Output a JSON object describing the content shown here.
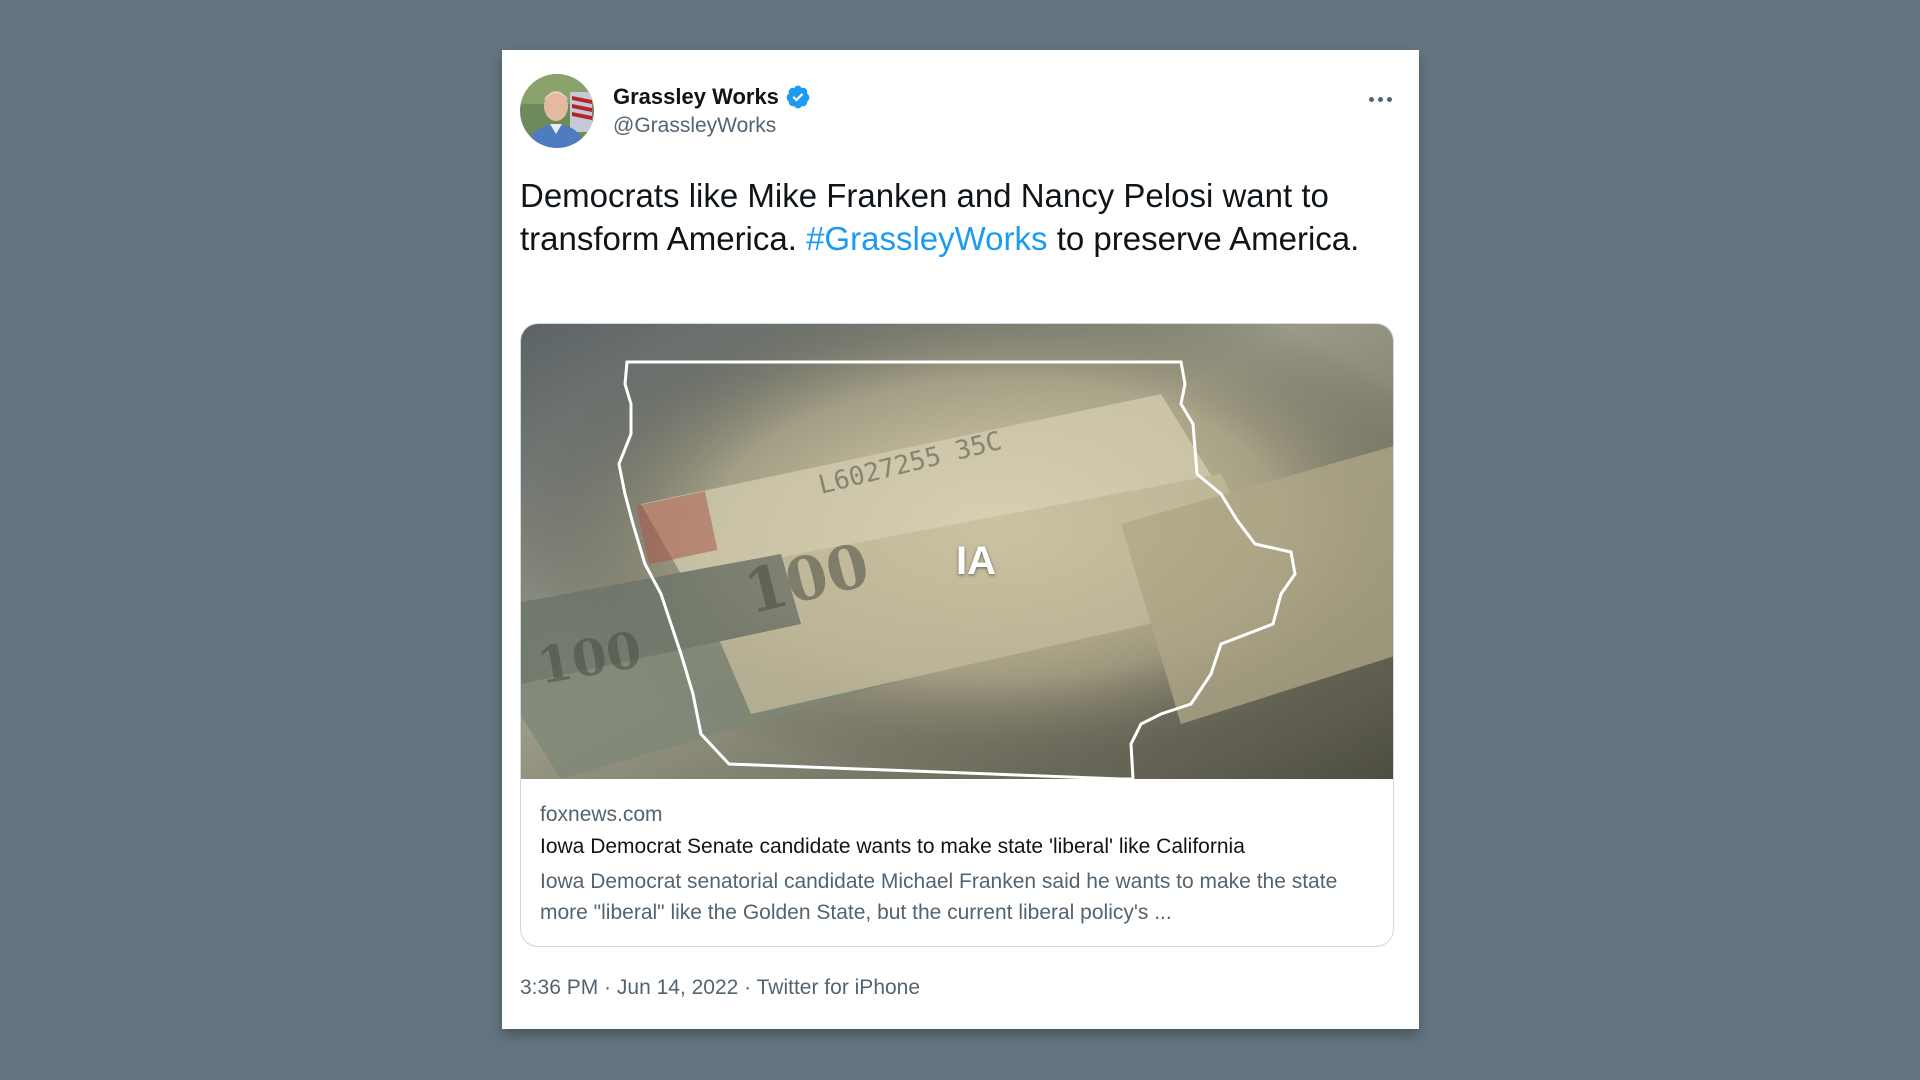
{
  "tweet": {
    "author": {
      "display_name": "Grassley Works",
      "handle": "@GrassleyWorks",
      "verified_icon": "verified-badge-icon",
      "avatar_icon": "profile-photo-avatar"
    },
    "more_icon": "more-options-icon",
    "text": {
      "part1": "Democrats like Mike Franken and Nancy Pelosi want to transform America. ",
      "hashtag": "#GrassleyWorks",
      "part2": " to preserve America."
    },
    "link_card": {
      "image_label": "IA",
      "domain": "foxnews.com",
      "title": "Iowa Democrat Senate candidate wants to make state 'liberal' like California",
      "description": "Iowa Democrat senatorial candidate Michael Franken said he wants to make the state more \"liberal\" like the Golden State, but the current liberal policy's ..."
    },
    "meta": {
      "time": "3:36 PM",
      "sep1": " · ",
      "date": "Jun 14, 2022",
      "sep2": " · ",
      "source": "Twitter for iPhone"
    }
  },
  "colors": {
    "background": "#647581",
    "link_blue": "#1d9bf0",
    "text_primary": "#0f1419",
    "text_secondary": "#536471",
    "verified": "#1d9bf0"
  }
}
